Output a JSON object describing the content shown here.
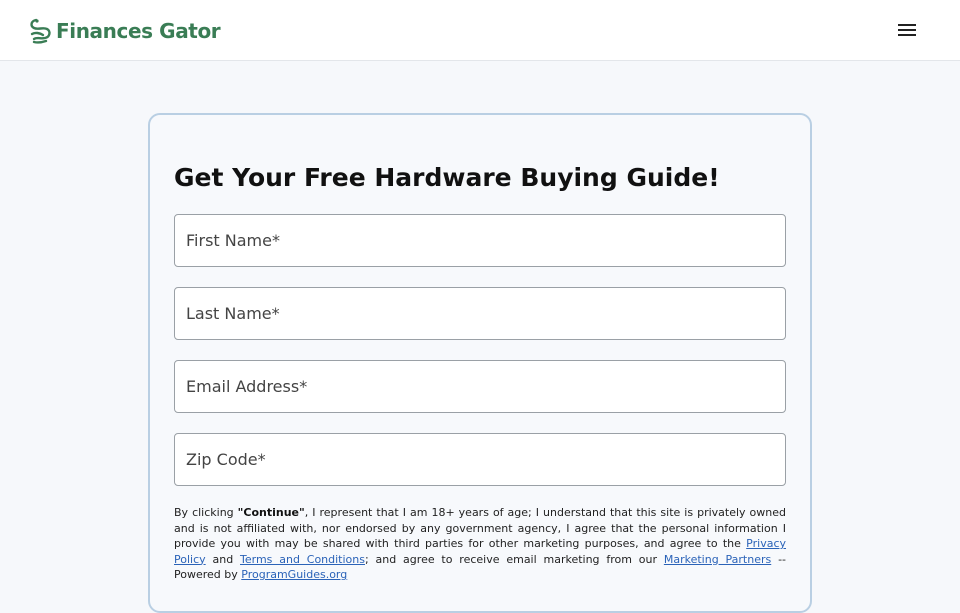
{
  "header": {
    "brand": "Finances Gator",
    "brand_color": "#3a7d55",
    "logo_icon": "gator-coil-icon",
    "menu_icon": "hamburger-menu-icon"
  },
  "form": {
    "title": "Get Your Free Hardware Buying Guide!",
    "fields": [
      {
        "placeholder": "First Name*",
        "value": ""
      },
      {
        "placeholder": "Last Name*",
        "value": ""
      },
      {
        "placeholder": "Email Address*",
        "value": ""
      },
      {
        "placeholder": "Zip Code*",
        "value": ""
      }
    ]
  },
  "disclaimer": {
    "prefix": "By clicking ",
    "continue_word": "\"Continue\"",
    "part1": ", I represent that I am 18+ years of age; I understand that this site is privately owned and is not affiliated with, nor endorsed by any government agency, I agree that the personal information I provide you with may be shared with third parties for other marketing purposes, and agree to the ",
    "privacy_link": "Privacy Policy",
    "and_word": " and ",
    "terms_link": "Terms and Conditions",
    "part2": "; and agree to receive email marketing from our ",
    "partners_link": "Marketing Partners",
    "part3": " -- Powered by ",
    "powered_link": "ProgramGuides.org"
  }
}
